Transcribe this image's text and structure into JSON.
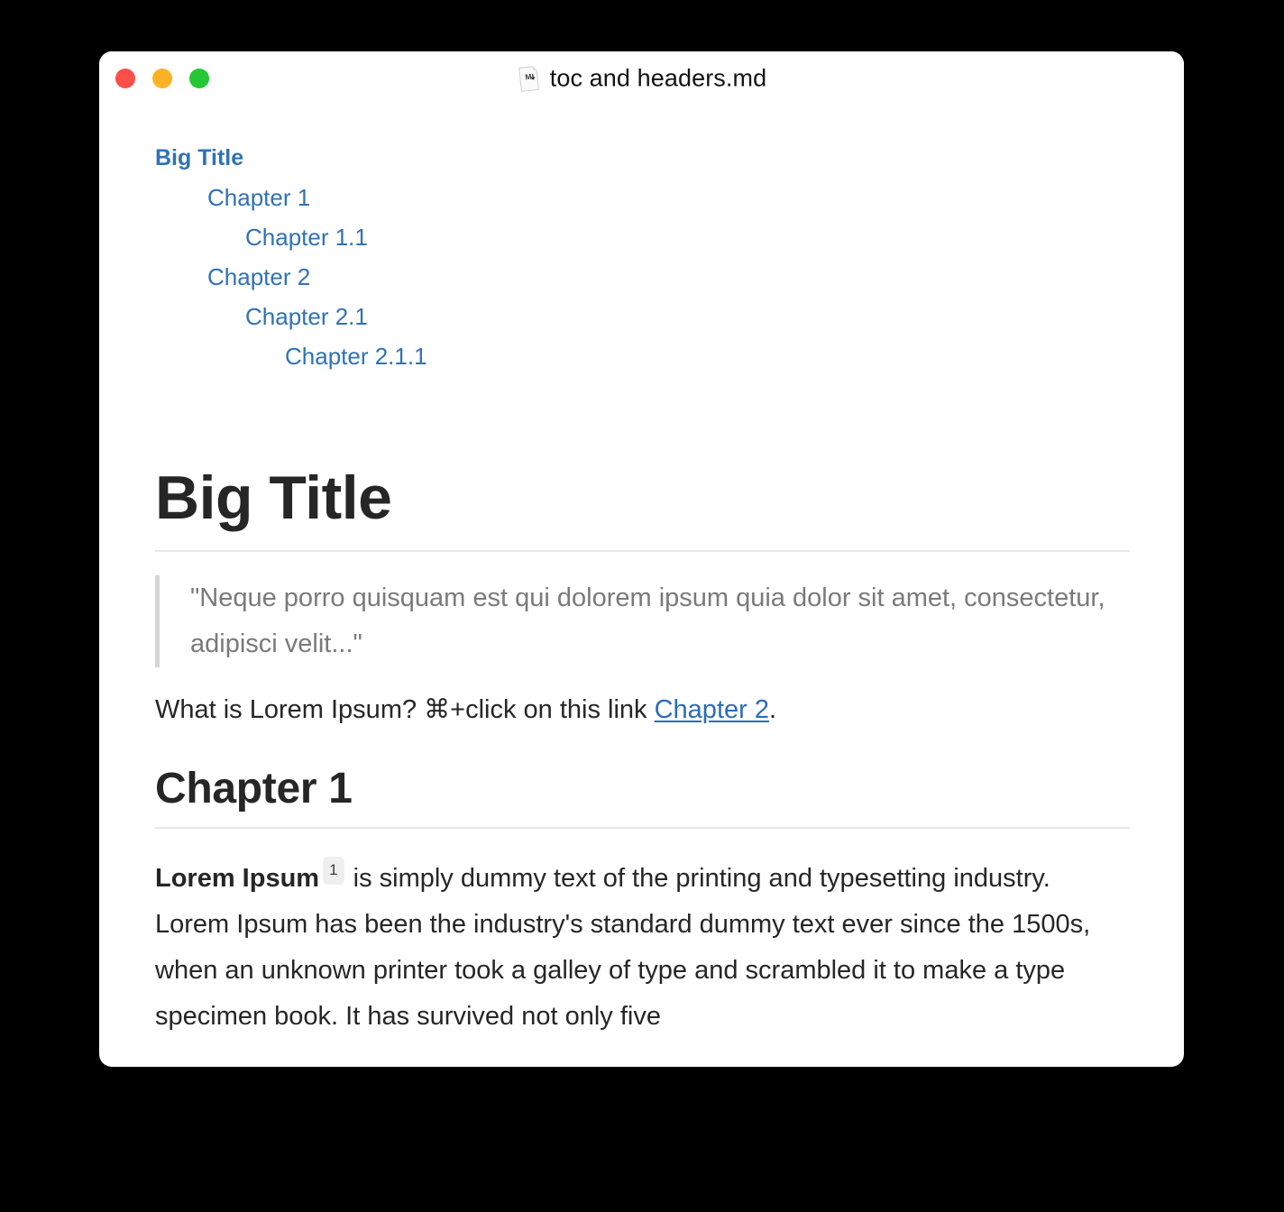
{
  "window": {
    "title": "toc and headers.md",
    "file_icon": "markdown-file-icon",
    "icon_glyph": "M↓",
    "traffic_lights": [
      {
        "name": "close",
        "label": "Close",
        "color": "#fd4f49"
      },
      {
        "name": "minimize",
        "label": "Minimize",
        "color": "#fcb226"
      },
      {
        "name": "zoom",
        "label": "Zoom",
        "color": "#25c732"
      }
    ]
  },
  "toc": {
    "items": [
      {
        "label": "Big Title",
        "level": 1
      },
      {
        "label": "Chapter 1",
        "level": 2
      },
      {
        "label": "Chapter 1.1",
        "level": 3
      },
      {
        "label": "Chapter 2",
        "level": 2
      },
      {
        "label": "Chapter 2.1",
        "level": 3
      },
      {
        "label": "Chapter 2.1.1",
        "level": 4
      }
    ]
  },
  "document": {
    "h1": "Big Title",
    "blockquote": "\"Neque porro quisquam est qui dolorem ipsum quia dolor sit amet, consectetur, adipisci velit...\"",
    "intro_paragraph": {
      "before_link": "What is Lorem Ipsum? ⌘+click on this link ",
      "link_label": "Chapter 2",
      "after_link": "."
    },
    "h2": "Chapter 1",
    "body_paragraph": {
      "bold_lead": "Lorem Ipsum",
      "footnote_marker": "1",
      "rest": " is simply dummy text of the printing and typesetting industry. Lorem Ipsum has been the industry's standard dummy text ever since the 1500s, when an unknown printer took a galley of type and scrambled it to make a type specimen book. It has survived not only five"
    }
  },
  "colors": {
    "link": "#3072b5",
    "doc_link": "#2b6cb8",
    "heading": "#262626",
    "quote_text": "#7a7a7a",
    "quote_border": "#d4d4d4",
    "rule": "#e7e7e7",
    "footnote_bg": "#efefef",
    "window_bg": "#ffffff",
    "desktop_bg": "#000000"
  }
}
